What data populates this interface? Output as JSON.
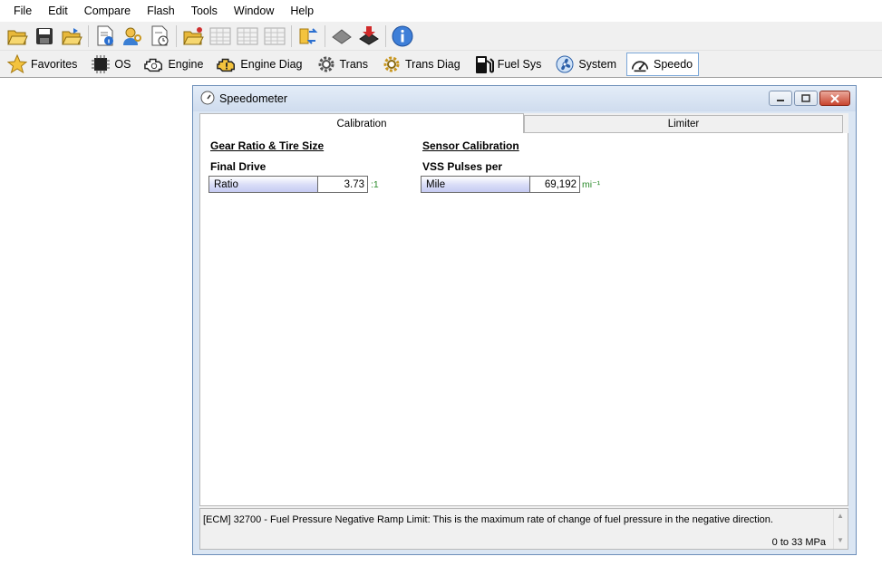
{
  "menu": [
    "File",
    "Edit",
    "Compare",
    "Flash",
    "Tools",
    "Window",
    "Help"
  ],
  "toolbar_icons": [
    "open-folder-icon",
    "save-icon",
    "open-recent-icon",
    "file-info-icon",
    "user-key-icon",
    "file-history-icon",
    "open-compare-icon",
    "table-icon",
    "table-icon",
    "table-icon",
    "swap-icon",
    "chip-icon",
    "chip-flash-icon",
    "info-icon"
  ],
  "modules": [
    {
      "label": "Favorites",
      "icon": "star-icon"
    },
    {
      "label": "OS",
      "icon": "chip-icon"
    },
    {
      "label": "Engine",
      "icon": "engine-icon"
    },
    {
      "label": "Engine Diag",
      "icon": "engine-warning-icon"
    },
    {
      "label": "Trans",
      "icon": "gear-icon"
    },
    {
      "label": "Trans Diag",
      "icon": "gear-diag-icon"
    },
    {
      "label": "Fuel Sys",
      "icon": "fuel-pump-icon"
    },
    {
      "label": "System",
      "icon": "fan-icon"
    },
    {
      "label": "Speedo",
      "icon": "speedometer-icon"
    }
  ],
  "window": {
    "title": "Speedometer",
    "tabs": [
      "Calibration",
      "Limiter"
    ],
    "sections": {
      "gear": {
        "title": "Gear Ratio & Tire Size",
        "field_label": "Final Drive",
        "field_name": "Ratio",
        "field_value": "3.73",
        "unit": ":1"
      },
      "sensor": {
        "title": "Sensor Calibration",
        "field_label": "VSS Pulses per",
        "field_name": "Mile",
        "field_value": "69,192",
        "unit": "mi⁻¹"
      }
    },
    "description": "[ECM] 32700 - Fuel Pressure Negative Ramp Limit: This is the maximum rate of change of fuel pressure in the negative direction.",
    "range": "0 to 33 MPa"
  }
}
